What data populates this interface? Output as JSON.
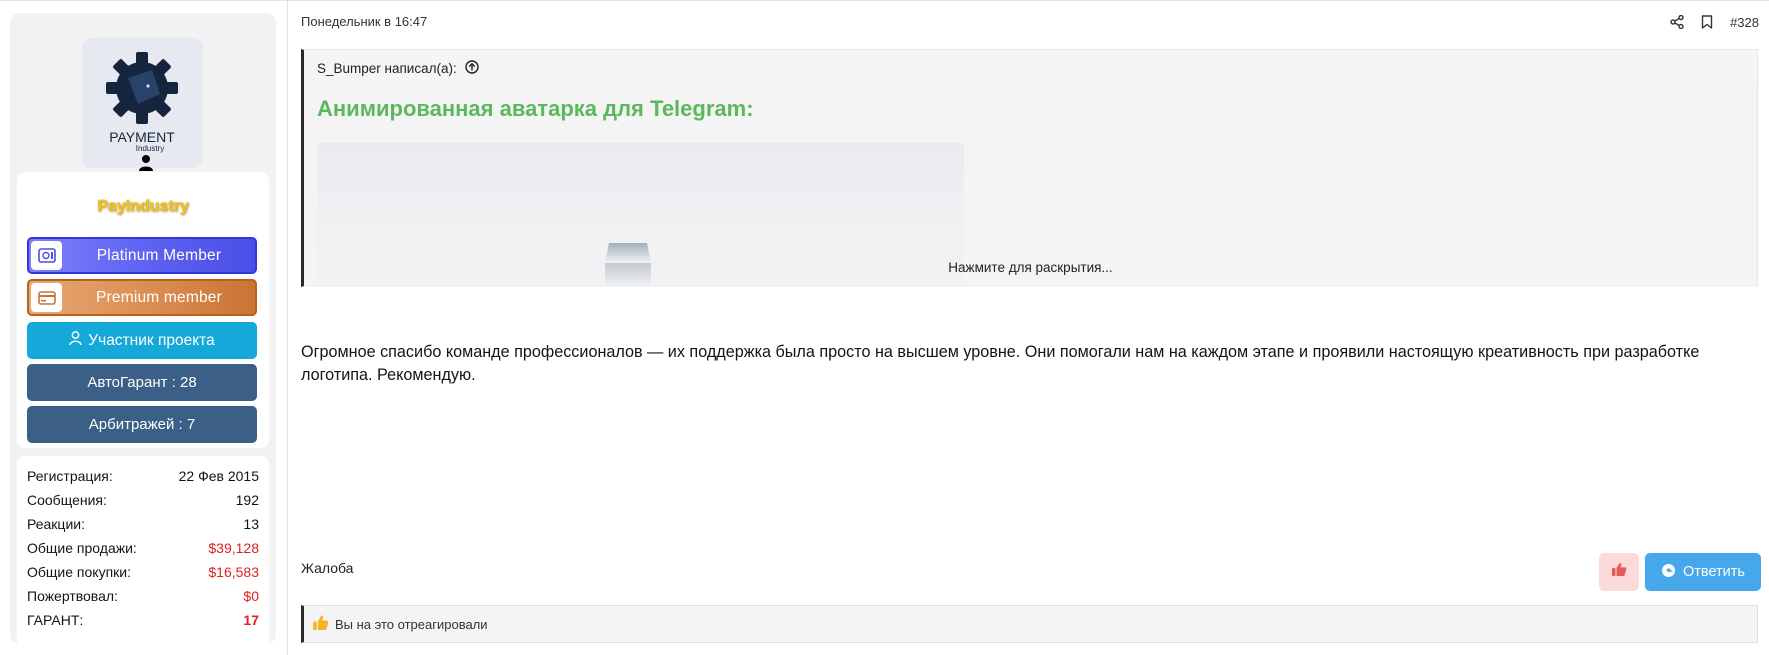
{
  "user": {
    "username": "PayIndustry",
    "avatar_text": {
      "line1": "PAYMENT",
      "line2": "Industry"
    },
    "banners": {
      "platinum": "Platinum Member",
      "premium": "Premium member",
      "participant": "Участник проекта",
      "autogarant": "АвтоГарант : 28",
      "arbitrage": "Арбитражей : 7"
    },
    "stats": [
      {
        "label": "Регистрация:",
        "value": "22 Фев 2015"
      },
      {
        "label": "Сообщения:",
        "value": "192"
      },
      {
        "label": "Реакции:",
        "value": "13"
      },
      {
        "label": "Общие продажи:",
        "value": "$39,128"
      },
      {
        "label": "Общие покупки:",
        "value": "$16,583"
      },
      {
        "label": "Пожертвовал:",
        "value": "$0"
      },
      {
        "label": "ГАРАНТ:",
        "value": "17"
      }
    ]
  },
  "post": {
    "date": "Понедельник в 16:47",
    "number": "#328",
    "quote": {
      "author_line": "S_Bumper написал(а):",
      "title": "Анимированная аватарка для Telegram:",
      "expand_label": "Нажмите для раскрытия..."
    },
    "message": "Огромное спасибо команде профессионалов — их поддержка была просто на высшем уровне. Они помогали нам на каждом этапе и проявили настоящую креативность при разработке логотипа. Рекомендую.",
    "report_label": "Жалоба",
    "reply_label": "Ответить",
    "reactions_text": "Вы на это отреагировали"
  },
  "colors": {
    "accent_blue": "#47a7eb",
    "quote_title_green": "#5cb85c",
    "username_gold": "#f5c518",
    "negative_red": "#e02020"
  }
}
